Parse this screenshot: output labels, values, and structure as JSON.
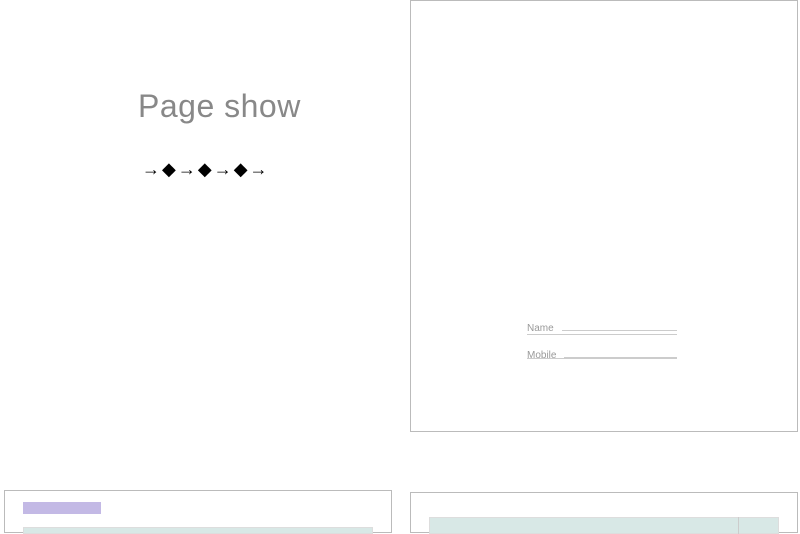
{
  "header": {
    "title": "Page show"
  },
  "form": {
    "name_label": "Name",
    "mobile_label": "Mobile"
  }
}
